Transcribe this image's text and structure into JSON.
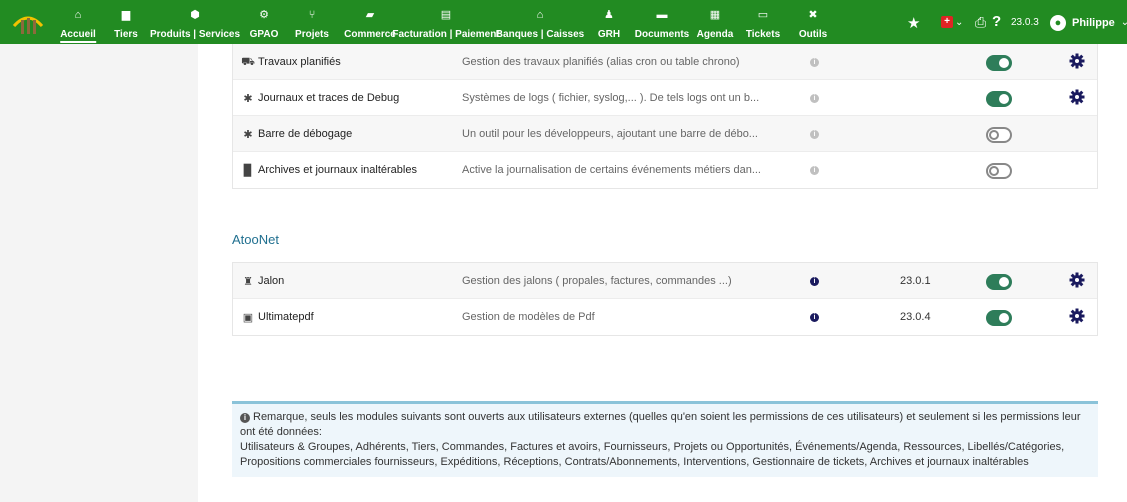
{
  "topnav": [
    {
      "label": "Accueil",
      "icon": "home-icon",
      "glyph": "⌂",
      "active": true
    },
    {
      "label": "Tiers",
      "icon": "building-icon",
      "glyph": "▆"
    },
    {
      "label": "Produits | Services",
      "icon": "cube-icon",
      "glyph": "⬢"
    },
    {
      "label": "GPAO",
      "icon": "cogs-icon",
      "glyph": "⚙"
    },
    {
      "label": "Projets",
      "icon": "sitemap-icon",
      "glyph": "⑂"
    },
    {
      "label": "Commerce",
      "icon": "suitcase-icon",
      "glyph": "▰"
    },
    {
      "label": "Facturation | Paiement",
      "icon": "invoice-icon",
      "glyph": "▤"
    },
    {
      "label": "Banques | Caisses",
      "icon": "bank-icon",
      "glyph": "⌂"
    },
    {
      "label": "GRH",
      "icon": "user-tie-icon",
      "glyph": "♟"
    },
    {
      "label": "Documents",
      "icon": "folder-icon",
      "glyph": "▬"
    },
    {
      "label": "Agenda",
      "icon": "calendar-icon",
      "glyph": "▦"
    },
    {
      "label": "Tickets",
      "icon": "ticket-icon",
      "glyph": "▭"
    },
    {
      "label": "Outils",
      "icon": "tools-icon",
      "glyph": "✖"
    }
  ],
  "header_right": {
    "version": "23.0.3",
    "user_name": "Philippe",
    "flag_glyph": "+",
    "caret": "⌄"
  },
  "modules_top": [
    {
      "icon": "tasks-icon",
      "glyph": "⛟",
      "name": "Travaux planifiés",
      "desc": "Gestion des travaux planifiés (alias cron ou table chrono)",
      "info_active": false,
      "version": "",
      "enabled": true,
      "has_settings": true
    },
    {
      "icon": "bug-icon",
      "glyph": "✱",
      "name": "Journaux et traces de Debug",
      "desc": "Systèmes de logs ( fichier, syslog,... ). De tels logs ont un b...",
      "info_active": false,
      "version": "",
      "enabled": true,
      "has_settings": true
    },
    {
      "icon": "bug-icon",
      "glyph": "✱",
      "name": "Barre de débogage",
      "desc": "Un outil pour les développeurs, ajoutant une barre de débo...",
      "info_active": false,
      "version": "",
      "enabled": false,
      "has_settings": false
    },
    {
      "icon": "file-icon",
      "glyph": "▉",
      "name": "Archives et journaux inaltérables",
      "desc": "Active la journalisation de certains événements métiers dan...",
      "info_active": false,
      "version": "",
      "enabled": false,
      "has_settings": false
    }
  ],
  "section_title": "AtooNet",
  "modules_atoonet": [
    {
      "icon": "milestone-icon",
      "glyph": "♜",
      "name": "Jalon",
      "desc": "Gestion des jalons ( propales, factures, commandes ...)",
      "info_active": true,
      "version": "23.0.1",
      "enabled": true,
      "has_settings": true
    },
    {
      "icon": "pdf-icon",
      "glyph": "▣",
      "name": "Ultimatepdf",
      "desc": "Gestion de modèles de Pdf",
      "info_active": true,
      "version": "23.0.4",
      "enabled": true,
      "has_settings": true
    }
  ],
  "note": {
    "info_glyph": "i",
    "line1": "Remarque, seuls les modules suivants sont ouverts aux utilisateurs externes (quelles qu'en soient les permissions de ces utilisateurs) et seulement si les permissions leur ont été données:",
    "line2": "Utilisateurs & Groupes, Adhérents, Tiers, Commandes, Factures et avoirs, Fournisseurs, Projets ou Opportunités, Événements/Agenda, Ressources, Libellés/Catégories, Propositions commerciales fournisseurs, Expéditions, Réceptions, Contrats/Abonnements, Interventions, Gestionnaire de tickets, Archives et journaux inaltérables"
  },
  "colors": {
    "topbar": "#228b22",
    "toggle_on": "#2e7d5a",
    "section_title": "#1f6f8f",
    "note_bg": "#eef6fb"
  }
}
